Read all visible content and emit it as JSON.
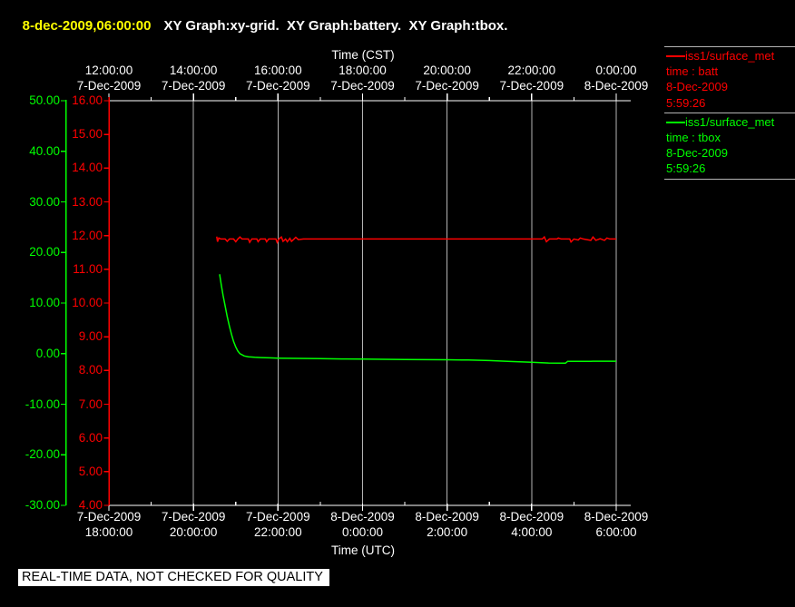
{
  "header": {
    "timestamp": "8-dec-2009,06:00:00",
    "graphs": "XY Graph:xy-grid.  XY Graph:battery.  XY Graph:tbox."
  },
  "colors": {
    "background": "#000000",
    "axis": "#ffffff",
    "grid": "#b4b4b4",
    "batt": "#ff0000",
    "tbox": "#00ff00",
    "title_timestamp": "#ffff00",
    "notice_bg": "#ffffff",
    "notice_text": "#000000"
  },
  "legend": {
    "entries": [
      {
        "source": "iss1/surface_met",
        "field": "time : batt",
        "date": "8-Dec-2009",
        "time": "5:59:26",
        "color": "#ff0000",
        "id": "batt"
      },
      {
        "source": "iss1/surface_met",
        "field": "time : tbox",
        "date": "8-Dec-2009",
        "time": "5:59:26",
        "color": "#00ff00",
        "id": "tbox"
      }
    ]
  },
  "notice": {
    "text": "REAL-TIME DATA, NOT CHECKED FOR QUALITY"
  },
  "chart_data": {
    "type": "line",
    "x_axis": {
      "top_label": "Time (CST)",
      "bottom_label": "Time (UTC)",
      "utc_hour_range": [
        18,
        30
      ],
      "major_tick_every_hours": 2,
      "minor_tick_every_hours": 1,
      "grid": "vertical-only",
      "top_ticks": [
        {
          "time": "12:00:00",
          "date": "7-Dec-2009"
        },
        {
          "time": "14:00:00",
          "date": "7-Dec-2009"
        },
        {
          "time": "16:00:00",
          "date": "7-Dec-2009"
        },
        {
          "time": "18:00:00",
          "date": "7-Dec-2009"
        },
        {
          "time": "20:00:00",
          "date": "7-Dec-2009"
        },
        {
          "time": "22:00:00",
          "date": "7-Dec-2009"
        },
        {
          "time": "0:00:00",
          "date": "8-Dec-2009"
        }
      ],
      "bottom_ticks": [
        {
          "date": "7-Dec-2009",
          "time": "18:00:00"
        },
        {
          "date": "7-Dec-2009",
          "time": "20:00:00"
        },
        {
          "date": "7-Dec-2009",
          "time": "22:00:00"
        },
        {
          "date": "8-Dec-2009",
          "time": "0:00:00"
        },
        {
          "date": "8-Dec-2009",
          "time": "2:00:00"
        },
        {
          "date": "8-Dec-2009",
          "time": "4:00:00"
        },
        {
          "date": "8-Dec-2009",
          "time": "6:00:00"
        }
      ]
    },
    "y_axes": [
      {
        "id": "tbox",
        "side": "outer-left",
        "color": "#00ff00",
        "range": [
          -30,
          50
        ],
        "tick_labels": [
          "50.00",
          "40.00",
          "30.00",
          "20.00",
          "10.00",
          "0.00",
          "-10.00",
          "-20.00",
          "-30.00"
        ],
        "tick_values": [
          50,
          40,
          30,
          20,
          10,
          0,
          -10,
          -20,
          -30
        ]
      },
      {
        "id": "batt",
        "side": "inner-left",
        "color": "#ff0000",
        "range": [
          4,
          16
        ],
        "tick_labels": [
          "16.00",
          "15.00",
          "14.00",
          "13.00",
          "12.00",
          "11.00",
          "10.00",
          "9.00",
          "8.00",
          "7.00",
          "6.00",
          "5.00",
          "4.00"
        ],
        "tick_values": [
          16,
          15,
          14,
          13,
          12,
          11,
          10,
          9,
          8,
          7,
          6,
          5,
          4
        ]
      }
    ],
    "series": [
      {
        "id": "batt",
        "name": "iss1/surface_met time : batt",
        "axis": "batt",
        "color": "#ff0000",
        "points": [
          [
            20.55,
            11.97
          ],
          [
            20.57,
            11.82
          ],
          [
            20.6,
            11.93
          ],
          [
            20.65,
            11.9
          ],
          [
            20.75,
            11.9
          ],
          [
            20.8,
            11.83
          ],
          [
            20.85,
            11.9
          ],
          [
            20.95,
            11.9
          ],
          [
            21.0,
            11.82
          ],
          [
            21.05,
            11.9
          ],
          [
            21.1,
            11.96
          ],
          [
            21.15,
            11.9
          ],
          [
            21.3,
            11.9
          ],
          [
            21.33,
            11.8
          ],
          [
            21.38,
            11.9
          ],
          [
            21.5,
            11.9
          ],
          [
            21.53,
            11.82
          ],
          [
            21.58,
            11.9
          ],
          [
            21.7,
            11.9
          ],
          [
            21.73,
            11.82
          ],
          [
            21.78,
            11.9
          ],
          [
            21.95,
            11.9
          ],
          [
            21.98,
            11.8
          ],
          [
            22.02,
            11.9
          ],
          [
            22.08,
            11.96
          ],
          [
            22.12,
            11.83
          ],
          [
            22.18,
            11.9
          ],
          [
            22.22,
            11.82
          ],
          [
            22.28,
            11.92
          ],
          [
            22.32,
            11.83
          ],
          [
            22.38,
            11.9
          ],
          [
            22.42,
            11.95
          ],
          [
            22.48,
            11.88
          ],
          [
            22.6,
            11.9
          ],
          [
            23.0,
            11.9
          ],
          [
            24.0,
            11.9
          ],
          [
            25.0,
            11.9
          ],
          [
            26.0,
            11.9
          ],
          [
            27.0,
            11.9
          ],
          [
            28.0,
            11.9
          ],
          [
            28.25,
            11.9
          ],
          [
            28.3,
            11.96
          ],
          [
            28.35,
            11.82
          ],
          [
            28.42,
            11.9
          ],
          [
            28.6,
            11.9
          ],
          [
            28.63,
            11.93
          ],
          [
            28.7,
            11.9
          ],
          [
            28.9,
            11.9
          ],
          [
            28.93,
            11.81
          ],
          [
            29.0,
            11.9
          ],
          [
            29.1,
            11.87
          ],
          [
            29.15,
            11.93
          ],
          [
            29.22,
            11.9
          ],
          [
            29.4,
            11.86
          ],
          [
            29.45,
            11.96
          ],
          [
            29.52,
            11.86
          ],
          [
            29.62,
            11.91
          ],
          [
            29.72,
            11.86
          ],
          [
            29.78,
            11.93
          ],
          [
            29.85,
            11.9
          ],
          [
            30.0,
            11.9
          ]
        ]
      },
      {
        "id": "tbox",
        "name": "iss1/surface_met time : tbox",
        "axis": "tbox",
        "color": "#00ff00",
        "points": [
          [
            20.62,
            15.7
          ],
          [
            20.66,
            13.5
          ],
          [
            20.7,
            11.5
          ],
          [
            20.75,
            9.4
          ],
          [
            20.8,
            7.3
          ],
          [
            20.85,
            5.4
          ],
          [
            20.9,
            3.8
          ],
          [
            20.95,
            2.4
          ],
          [
            21.0,
            1.3
          ],
          [
            21.05,
            0.5
          ],
          [
            21.1,
            0.0
          ],
          [
            21.2,
            -0.45
          ],
          [
            21.3,
            -0.62
          ],
          [
            21.45,
            -0.72
          ],
          [
            21.6,
            -0.78
          ],
          [
            21.8,
            -0.84
          ],
          [
            22.0,
            -0.88
          ],
          [
            22.5,
            -0.95
          ],
          [
            23.0,
            -1.0
          ],
          [
            23.5,
            -1.05
          ],
          [
            24.0,
            -1.08
          ],
          [
            24.5,
            -1.12
          ],
          [
            25.0,
            -1.16
          ],
          [
            25.5,
            -1.19
          ],
          [
            26.0,
            -1.21
          ],
          [
            26.5,
            -1.27
          ],
          [
            27.0,
            -1.38
          ],
          [
            27.5,
            -1.55
          ],
          [
            28.0,
            -1.72
          ],
          [
            28.4,
            -1.85
          ],
          [
            28.8,
            -1.89
          ],
          [
            28.85,
            -1.53
          ],
          [
            29.4,
            -1.53
          ],
          [
            29.45,
            -1.5
          ],
          [
            30.0,
            -1.5
          ]
        ]
      }
    ]
  }
}
